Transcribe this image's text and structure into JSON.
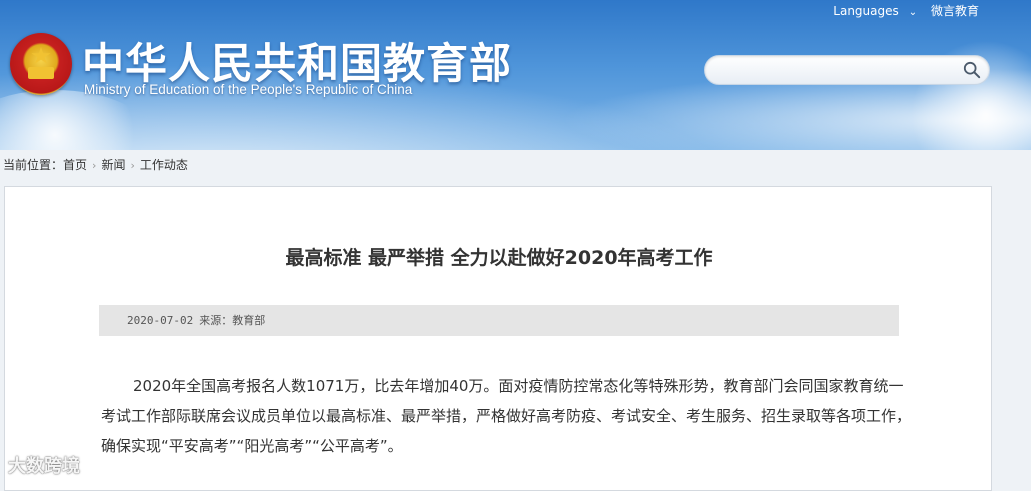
{
  "header": {
    "site_title": "中华人民共和国教育部",
    "site_subtitle": "Ministry of Education of the People's Republic of China",
    "top_links": {
      "languages": "Languages",
      "weibo": "微言教育"
    },
    "search": {
      "placeholder": ""
    }
  },
  "breadcrumb": {
    "prefix": "当前位置：",
    "items": [
      "首页",
      "新闻",
      "工作动态"
    ]
  },
  "article": {
    "title": "最高标准 最严举措 全力以赴做好2020年高考工作",
    "date": "2020-07-02",
    "source": "来源：教育部",
    "body": "2020年全国高考报名人数1071万，比去年增加40万。面对疫情防控常态化等特殊形势，教育部门会同国家教育统一考试工作部际联席会议成员单位以最高标准、最严举措，严格做好高考防疫、考试安全、考生服务、招生录取等各项工作，确保实现“平安高考”“阳光高考”“公平高考”。"
  },
  "watermark": "大数跨境",
  "colors": {
    "header_blue": "#2f78c9",
    "meta_bar": "#e5e5e5",
    "text": "#333333"
  }
}
